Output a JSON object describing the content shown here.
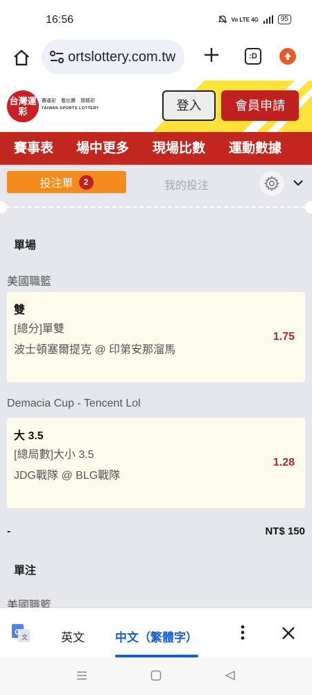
{
  "status": {
    "time": "16:56",
    "network": "Vo LTE 4G",
    "battery": "95"
  },
  "browser": {
    "url": "ortslottery.com.tw",
    "tabs_label": ":D"
  },
  "site": {
    "logo_mark": "台灣運彩",
    "logo_line1": "賽運彩　看比賽　買精彩",
    "logo_line2": "TAIWAN SPORTS LOTTERY",
    "login_label": "登入",
    "register_label": "會員申請"
  },
  "nav": {
    "items": [
      "賽事表",
      "場中更多",
      "現場比數",
      "運動數據"
    ]
  },
  "betslip": {
    "tab_label": "投注單",
    "count": "2",
    "mybets_label": "我的投注",
    "section_single": "單場",
    "bets": [
      {
        "league": "美國職籃",
        "pick": "雙",
        "market": "[總分]單雙",
        "match": "波士頓塞爾提克 @ 印第安那溜馬",
        "odds": "1.75"
      },
      {
        "league": "Demacia Cup - Tencent Lol",
        "pick": "大 3.5",
        "market": "[總局數]大小 3.5",
        "match": "JDG戰隊 @ BLG戰隊",
        "odds": "1.28"
      }
    ],
    "stake_dash": "-",
    "stake_amount": "NT$ 150",
    "section_singles": "單注",
    "next_league": "美國職籃"
  },
  "translate": {
    "lang_source": "英文",
    "lang_target": "中文（繁體字）"
  },
  "colors": {
    "brand_red": "#c2271f",
    "orange": "#f38b1f",
    "odds_red": "#b3262c",
    "accent_blue": "#1a5fd0"
  }
}
